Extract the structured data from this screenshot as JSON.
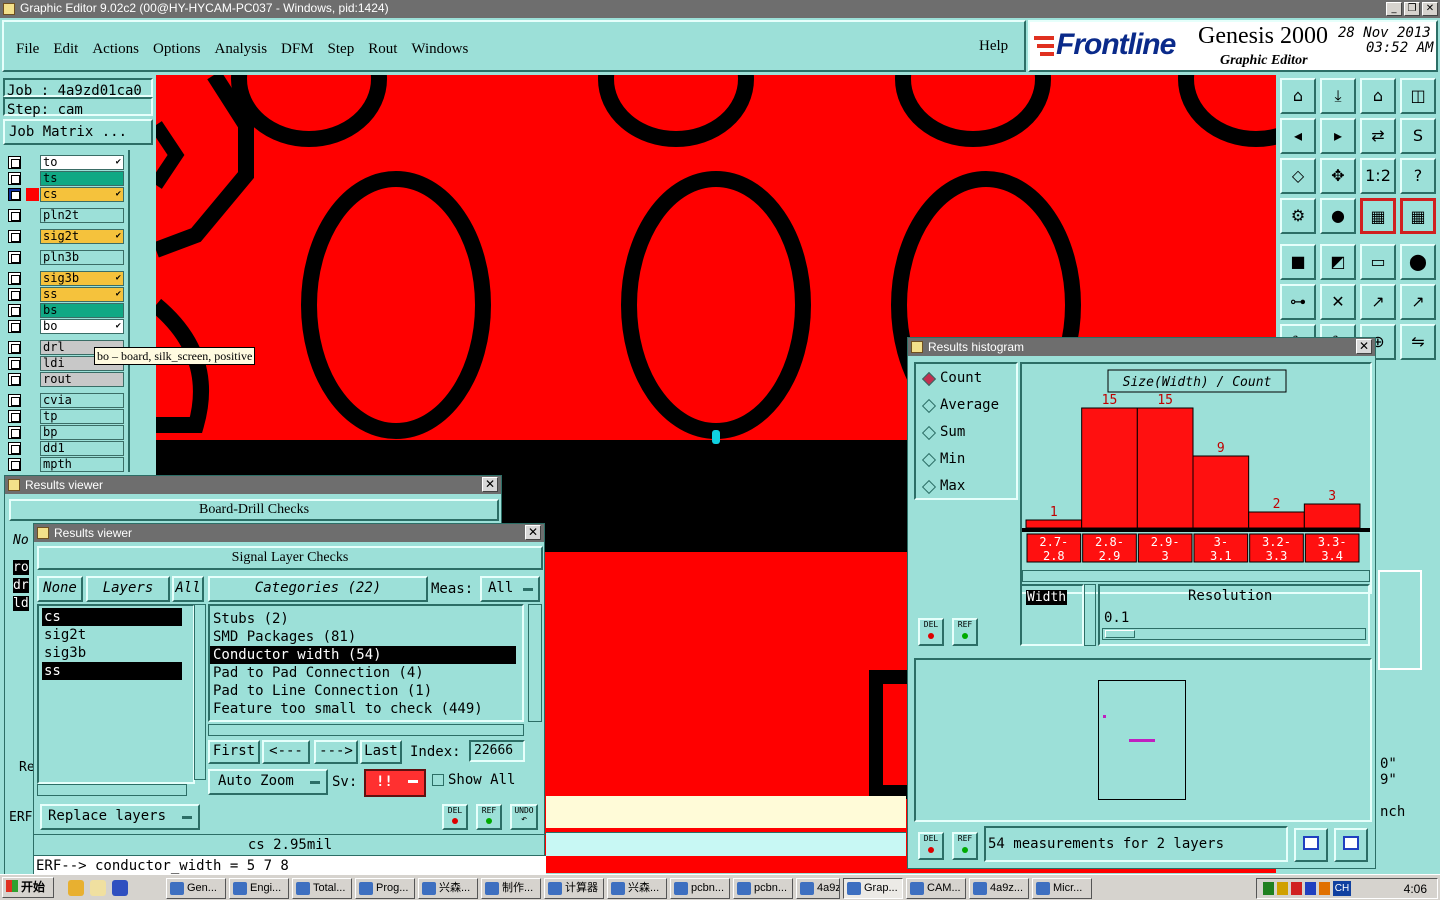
{
  "window": {
    "title": "Graphic Editor 9.02c2 (00@HY-HYCAM-PC037 - Windows, pid:1424)"
  },
  "menu": [
    "File",
    "Edit",
    "Actions",
    "Options",
    "Analysis",
    "DFM",
    "Step",
    "Rout",
    "Windows"
  ],
  "help": "Help",
  "brand": {
    "logo": "Frontline",
    "product": "Genesis 2000",
    "subtitle": "Graphic Editor",
    "date": "28 Nov 2013",
    "time": "03:52 AM"
  },
  "job": {
    "job_label": "Job : 4a9zd01ca0",
    "step_label": "Step: cam",
    "matrix_button": "Job Matrix ..."
  },
  "layers": [
    {
      "name": "to",
      "color": "#ffffff",
      "mark": "✔"
    },
    {
      "name": "ts",
      "color": "#10a884",
      "mark": ""
    },
    {
      "name": "cs",
      "color": "#f5c23c",
      "mark": "✔"
    },
    {
      "name": "pln2t",
      "color": "#9ce0d8",
      "mark": ""
    },
    {
      "name": "sig2t",
      "color": "#f5c23c",
      "mark": "✔"
    },
    {
      "name": "pln3b",
      "color": "#9ce0d8",
      "mark": ""
    },
    {
      "name": "sig3b",
      "color": "#f5c23c",
      "mark": "✔"
    },
    {
      "name": "ss",
      "color": "#f5c23c",
      "mark": "✔"
    },
    {
      "name": "bs",
      "color": "#10a884",
      "mark": ""
    },
    {
      "name": "bo",
      "color": "#ffffff",
      "mark": "✔"
    },
    {
      "name": "drl",
      "color": "#c8c8c8",
      "mark": ""
    },
    {
      "name": "ldi",
      "color": "#c8c8c8",
      "mark": ""
    },
    {
      "name": "rout",
      "color": "#c8c8c8",
      "mark": ""
    },
    {
      "name": "cvia",
      "color": "#9ce0d8",
      "mark": ""
    },
    {
      "name": "tp",
      "color": "#9ce0d8",
      "mark": ""
    },
    {
      "name": "bp",
      "color": "#9ce0d8",
      "mark": ""
    },
    {
      "name": "dd1",
      "color": "#9ce0d8",
      "mark": ""
    },
    {
      "name": "mpth",
      "color": "#9ce0d8",
      "mark": ""
    }
  ],
  "tooltip": "bo – board, silk_screen, positive",
  "results_viewer_1": {
    "title": "Results viewer",
    "header": "Board-Drill Checks",
    "side_labels": [
      "No",
      "ro",
      "dr",
      "ld",
      "Re",
      "ERF"
    ]
  },
  "results_viewer_2": {
    "title": "Results viewer",
    "header": "Signal Layer Checks",
    "none_btn": "None",
    "layers_btn": "Layers",
    "all_btn": "All",
    "layer_list": [
      {
        "name": "cs",
        "selected": true
      },
      {
        "name": "sig2t",
        "selected": false
      },
      {
        "name": "sig3b",
        "selected": false
      },
      {
        "name": "ss",
        "selected": true
      }
    ],
    "categories_label": "Categories (22)",
    "meas_label": "Meas:",
    "meas_value": "All",
    "categories": [
      {
        "text": "Stubs (2)",
        "selected": false
      },
      {
        "text": "SMD Packages (81)",
        "selected": false
      },
      {
        "text": "Conductor width (54)",
        "selected": true
      },
      {
        "text": "Pad to Pad Connection (4)",
        "selected": false
      },
      {
        "text": "Pad to Line Connection (1)",
        "selected": false
      },
      {
        "text": "Feature too small to check (449)",
        "selected": false
      }
    ],
    "nav": {
      "first": "First",
      "prev": "<---",
      "next": "--->",
      "last": "Last",
      "index_label": "Index:",
      "index_value": "22666"
    },
    "auto_zoom": "Auto Zoom",
    "sv_label": "Sv:",
    "sv_value": "!!",
    "show_all": "Show All",
    "replace_layers": "Replace layers",
    "icon_labels": [
      "DEL",
      "REF",
      "UNDO"
    ],
    "status": "cs 2.95mil",
    "erf_line": "ERF--> conductor_width = 5 7 8"
  },
  "histogram": {
    "title": "Results histogram",
    "options": [
      {
        "label": "Count",
        "selected": true
      },
      {
        "label": "Average",
        "selected": false
      },
      {
        "label": "Sum",
        "selected": false
      },
      {
        "label": "Min",
        "selected": false
      },
      {
        "label": "Max",
        "selected": false
      }
    ],
    "icon_labels": [
      "DEL",
      "REF"
    ],
    "resolution_label": "Resolution",
    "resolution_value": "0.1",
    "width_label": "Width",
    "summary": "54 measurements for 2 layers"
  },
  "chart_data": {
    "type": "bar",
    "title": "Size(Width) / Count",
    "categories": [
      "2.7-2.8",
      "2.8-2.9",
      "2.9-3",
      "3-3.1",
      "3.2-3.3",
      "3.3-3.4"
    ],
    "values": [
      1,
      15,
      15,
      9,
      2,
      3
    ],
    "ylim": [
      0,
      15
    ],
    "bar_color": "#ff1010",
    "label_color": "#c00000"
  },
  "right_edge_text": [
    "0\"",
    "9\"",
    "nch"
  ],
  "taskbar": {
    "start": "开始",
    "items": [
      "Gen...",
      "Engi...",
      "Total...",
      "Prog...",
      "兴森...",
      "制作...",
      "计算器",
      "兴森...",
      "pcbn...",
      "pcbn...",
      "4a9z...",
      "Grap...",
      "CAM...",
      "4a9z...",
      "Micr..."
    ],
    "tray": [
      "CH"
    ],
    "clock": "4:06"
  },
  "colors": {
    "teal": "#9ce0d8",
    "copper": "#ff0000",
    "black": "#000000"
  }
}
